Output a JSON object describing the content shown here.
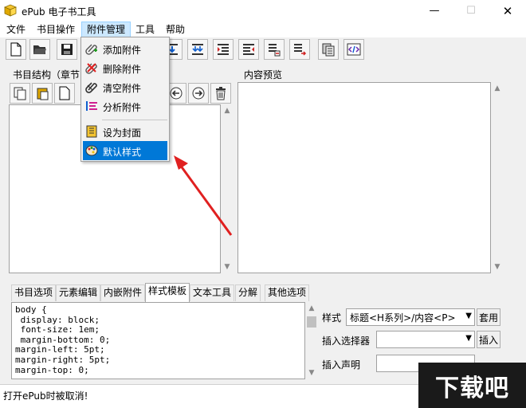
{
  "window": {
    "title": "ePub 电子书工具",
    "minimize_glyph": "—",
    "maximize_glyph": "☐",
    "close_glyph": "✕"
  },
  "menubar": {
    "file": "文件",
    "book_ops": "书目操作",
    "attachment_mgmt": "附件管理",
    "tools": "工具",
    "help": "帮助"
  },
  "attachment_menu": {
    "items": [
      {
        "label": "添加附件",
        "icon": "paperclip-add-icon"
      },
      {
        "label": "删除附件",
        "icon": "paperclip-delete-icon"
      },
      {
        "label": "清空附件",
        "icon": "paperclip-clear-icon"
      },
      {
        "label": "分析附件",
        "icon": "analyze-icon"
      },
      {
        "label": "设为封面",
        "icon": "cover-icon"
      },
      {
        "label": "默认样式",
        "icon": "palette-icon"
      }
    ],
    "highlighted": "默认样式"
  },
  "left_panel": {
    "label": "书目结构（章节"
  },
  "right_panel": {
    "label": "内容预览"
  },
  "tabs": [
    "书目选项",
    "元素编辑",
    "内嵌附件",
    "样式模板",
    "文本工具",
    "分解",
    "其他选项"
  ],
  "active_tab": "样式模板",
  "code_lines": [
    "body {",
    " display: block;",
    " font-size: 1em;",
    " margin-bottom: 0;",
    "margin-left: 5pt;",
    "margin-right: 5pt;",
    "margin-top: 0;"
  ],
  "style_form": {
    "style_label": "样式",
    "style_value": "标题<H系列>/内容<P>",
    "apply_button": "套用",
    "insert_selector_label": "插入选择器",
    "insert_selector_value": "",
    "insert_button": "插入",
    "insert_declaration_label": "插入声明",
    "insert_declaration_value": ""
  },
  "status": {
    "text": "打开ePub时被取消!"
  },
  "watermark": {
    "text": "下载吧"
  },
  "colors": {
    "menu_highlight": "#0078d7",
    "menubar_active": "#cce8ff",
    "arrow": "#e02020"
  }
}
